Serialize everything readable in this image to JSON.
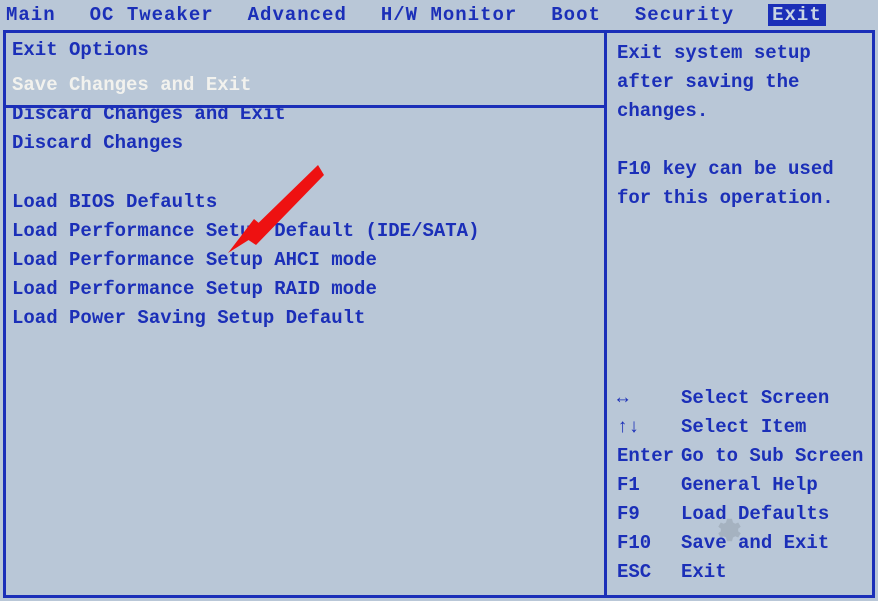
{
  "menubar": {
    "items": [
      {
        "label": "Main"
      },
      {
        "label": "OC Tweaker"
      },
      {
        "label": "Advanced"
      },
      {
        "label": "H/W Monitor"
      },
      {
        "label": "Boot"
      },
      {
        "label": "Security"
      },
      {
        "label": "Exit",
        "active": true
      }
    ]
  },
  "left": {
    "section_title": "Exit Options",
    "group1": [
      {
        "label": "Save Changes and Exit",
        "selected": true
      },
      {
        "label": "Discard Changes and Exit"
      },
      {
        "label": "Discard Changes"
      }
    ],
    "group2": [
      {
        "label": "Load BIOS Defaults"
      },
      {
        "label": "Load Performance Setup Default (IDE/SATA)"
      },
      {
        "label": "Load Performance Setup AHCI mode"
      },
      {
        "label": "Load Performance Setup RAID mode"
      },
      {
        "label": "Load Power Saving Setup Default"
      }
    ]
  },
  "right": {
    "help_line1": "Exit system setup",
    "help_line2": "after saving the",
    "help_line3": "changes.",
    "help_line4": "F10 key can be used",
    "help_line5": "for this operation.",
    "legend": [
      {
        "key": "↔",
        "label": "Select Screen"
      },
      {
        "key": "↑↓",
        "label": "Select Item"
      },
      {
        "key": "Enter",
        "label": "Go to Sub Screen"
      },
      {
        "key": "F1",
        "label": "General Help"
      },
      {
        "key": "F9",
        "label": "Load Defaults"
      },
      {
        "key": "F10",
        "label": "Save and Exit"
      },
      {
        "key": "ESC",
        "label": "Exit"
      }
    ]
  }
}
